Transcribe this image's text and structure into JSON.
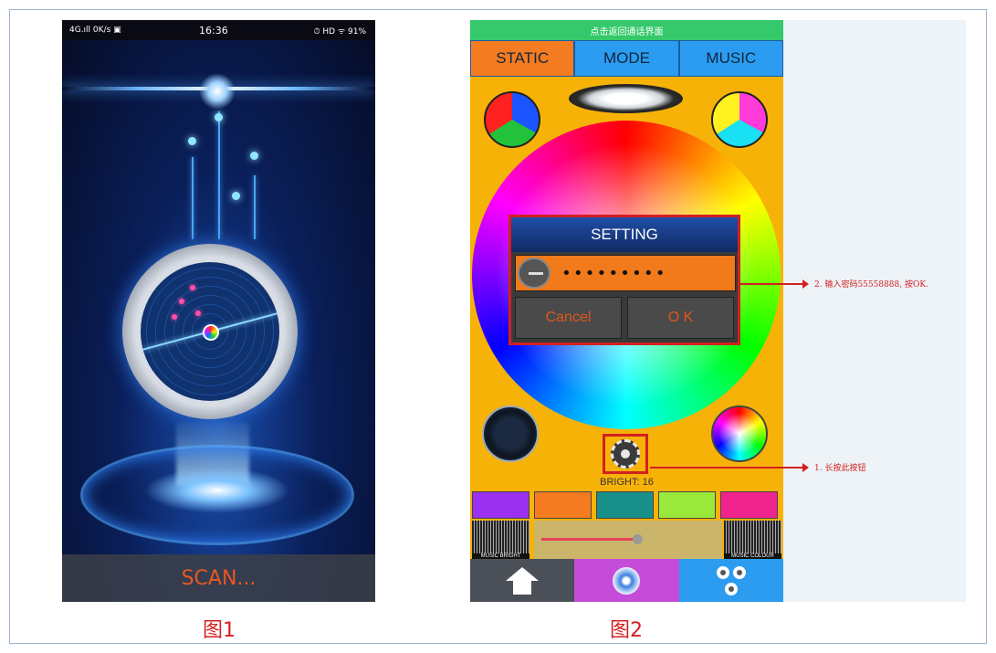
{
  "figure1": {
    "status_left": "4G.ıll 0K/s ▣",
    "status_time": "16:36",
    "status_right": "⏱ HD ᯤ 91%",
    "scan_label": "SCAN...",
    "caption": "图1"
  },
  "figure2": {
    "top_banner": "点击返回通话界面",
    "tabs": [
      {
        "label": "STATIC",
        "active": true
      },
      {
        "label": "MODE",
        "active": false
      },
      {
        "label": "MUSIC",
        "active": false
      }
    ],
    "dialog": {
      "title": "SETTING",
      "password_value": "•••••••••",
      "cancel_label": "Cancel",
      "ok_label": "O K"
    },
    "bright_label": "BRIGHT: 16",
    "music_bright_label": "MUSIC BRIGHT",
    "music_colour_label": "MUSIC COLOUR",
    "swatches": [
      "#9b30f0",
      "#f47b20",
      "#17908a",
      "#9ae83a",
      "#f0248c"
    ],
    "slider_value_percent": 55,
    "nav_items": [
      "home-icon",
      "music-disc-icon",
      "lights-icon"
    ],
    "caption": "图2"
  },
  "annotations": {
    "step2": "2. 输入密码55558888, 按OK.",
    "step1": "1. 长按此按钮"
  },
  "colors": {
    "annotation_red": "#d22020",
    "phone2_bg": "#f7b208",
    "tab_active": "#f47b20",
    "tab_inactive": "#2b9cf0",
    "scan_text": "#e8581f"
  }
}
